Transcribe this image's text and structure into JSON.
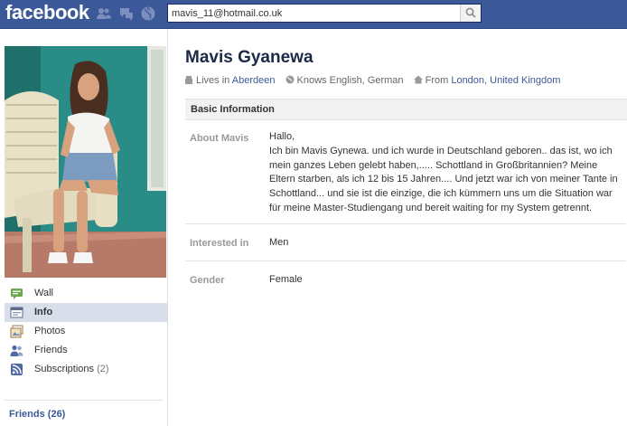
{
  "header": {
    "logo": "facebook",
    "search_value": "mavis_11@hotmail.co.uk",
    "brand_color": "#3b5998"
  },
  "sidebar": {
    "items": [
      {
        "label": "Wall",
        "icon": "wall-icon"
      },
      {
        "label": "Info",
        "icon": "info-icon",
        "active": true
      },
      {
        "label": "Photos",
        "icon": "photos-icon"
      },
      {
        "label": "Friends",
        "icon": "friends-icon"
      },
      {
        "label": "Subscriptions",
        "count": "(2)",
        "icon": "subscriptions-icon"
      }
    ],
    "friends_link": "Friends (26)"
  },
  "profile": {
    "name": "Mavis Gyanewa",
    "lives_in_prefix": "Lives in",
    "lives_in": "Aberdeen",
    "knows": "Knows English, German",
    "from_prefix": "From",
    "from_city": "London",
    "from_country": "United Kingdom"
  },
  "basic_info": {
    "title": "Basic Information",
    "about_label": "About Mavis",
    "about_value": "Hallo,\nIch bin Mavis Gynewa. und ich wurde in Deutschland geboren.. das ist, wo ich mein ganzes Leben gelebt haben,..... Schottland in Großbritannien? Meine Eltern starben, als ich 12 bis 15 Jahren.... Und jetzt war ich von meiner Tante in Schottland... und sie ist die einzige, die ich kümmern uns um die Situation war für meine Master-Studiengang und bereit waiting for my System getrennt.",
    "interested_label": "Interested in",
    "interested_value": "Men",
    "gender_label": "Gender",
    "gender_value": "Female"
  }
}
